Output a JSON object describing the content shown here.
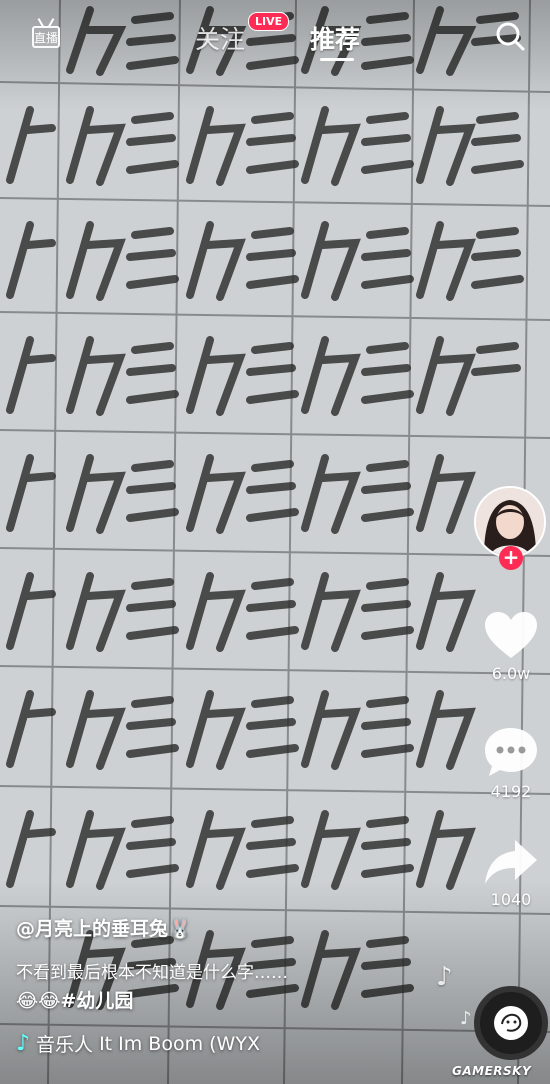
{
  "header": {
    "live_icon_text": "直播",
    "tabs": [
      {
        "label": "关注"
      },
      {
        "label": "推荐"
      }
    ],
    "live_badge": "LIVE"
  },
  "sidebar": {
    "like_count": "6.0w",
    "comment_count": "4192",
    "share_count": "1040"
  },
  "video": {
    "author": "@月亮上的垂耳兔🐰",
    "caption": "不看到最后根本不知道是什么字……",
    "tags": "😂😂#幼儿园",
    "music_label": "音乐人",
    "music_title": "It Im Boom (WYX"
  },
  "watermark": "GAMERSKY",
  "colors": {
    "accent": "#fe2c55",
    "paper": "#c9cdcf",
    "ink": "#2d2d2d"
  },
  "icons": [
    "search-icon",
    "heart-icon",
    "comment-icon",
    "share-icon",
    "music-note-icon",
    "music-disc-icon"
  ]
}
